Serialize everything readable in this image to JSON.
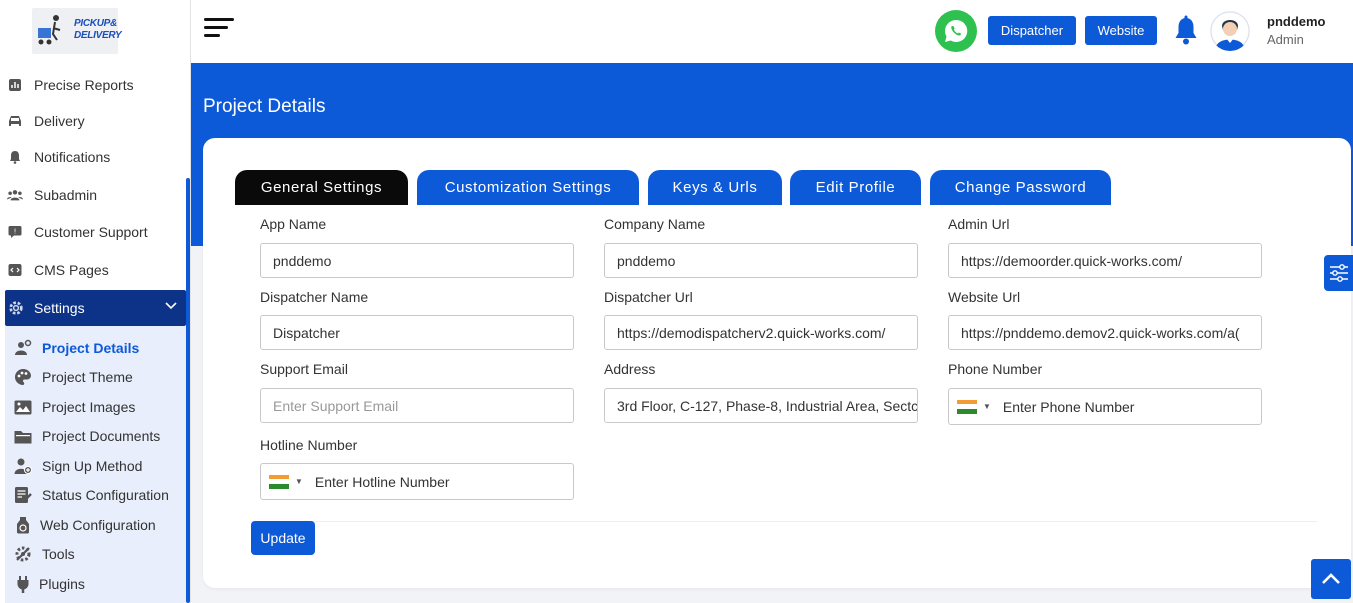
{
  "logo": {
    "line1": "PICKUP&",
    "line2": "DELIVERY"
  },
  "sidebar": {
    "items": [
      {
        "label": "Precise Reports",
        "icon": "report-icon"
      },
      {
        "label": "Delivery",
        "icon": "car-icon"
      },
      {
        "label": "Notifications",
        "icon": "bell-icon"
      },
      {
        "label": "Subadmin",
        "icon": "users-icon"
      },
      {
        "label": "Customer Support",
        "icon": "chat-icon"
      },
      {
        "label": "CMS Pages",
        "icon": "code-icon"
      }
    ],
    "settings": {
      "label": "Settings",
      "icon": "gear-icon"
    },
    "submenu": [
      {
        "label": "Project Details",
        "icon": "project-details-icon",
        "active": true
      },
      {
        "label": "Project Theme",
        "icon": "palette-icon"
      },
      {
        "label": "Project Images",
        "icon": "image-icon"
      },
      {
        "label": "Project Documents",
        "icon": "folder-icon"
      },
      {
        "label": "Sign Up Method",
        "icon": "signup-icon"
      },
      {
        "label": "Status Configuration",
        "icon": "status-icon"
      },
      {
        "label": "Web Configuration",
        "icon": "web-config-icon"
      },
      {
        "label": "Tools",
        "icon": "tools-icon"
      },
      {
        "label": "Plugins",
        "icon": "plug-icon"
      }
    ]
  },
  "header": {
    "dispatcher_label": "Dispatcher",
    "website_label": "Website",
    "user_name": "pnddemo",
    "user_role": "Admin"
  },
  "page": {
    "title": "Project Details"
  },
  "tabs": [
    {
      "label": "General Settings",
      "active": true
    },
    {
      "label": "Customization Settings"
    },
    {
      "label": "Keys & Urls"
    },
    {
      "label": "Edit Profile"
    },
    {
      "label": "Change Password"
    }
  ],
  "form": {
    "app_name": {
      "label": "App Name",
      "value": "pnddemo"
    },
    "company_name": {
      "label": "Company Name",
      "value": "pnddemo"
    },
    "admin_url": {
      "label": "Admin Url",
      "value": "https://demoorder.quick-works.com/"
    },
    "dispatcher_name": {
      "label": "Dispatcher Name",
      "value": "Dispatcher"
    },
    "dispatcher_url": {
      "label": "Dispatcher Url",
      "value": "https://demodispatcherv2.quick-works.com/"
    },
    "website_url": {
      "label": "Website Url",
      "value": "https://pnddemo.demov2.quick-works.com/a("
    },
    "support_email": {
      "label": "Support Email",
      "placeholder": "Enter Support Email"
    },
    "address": {
      "label": "Address",
      "value": "3rd Floor, C-127, Phase-8, Industrial Area, Sectc"
    },
    "phone_number": {
      "label": "Phone Number",
      "placeholder": "Enter Phone Number"
    },
    "hotline_number": {
      "label": "Hotline Number",
      "placeholder": "Enter Hotline Number"
    },
    "update_label": "Update"
  },
  "colors": {
    "primary": "#0d5ad9",
    "sidebar_active": "#0d3388",
    "whatsapp": "#2fc150"
  }
}
